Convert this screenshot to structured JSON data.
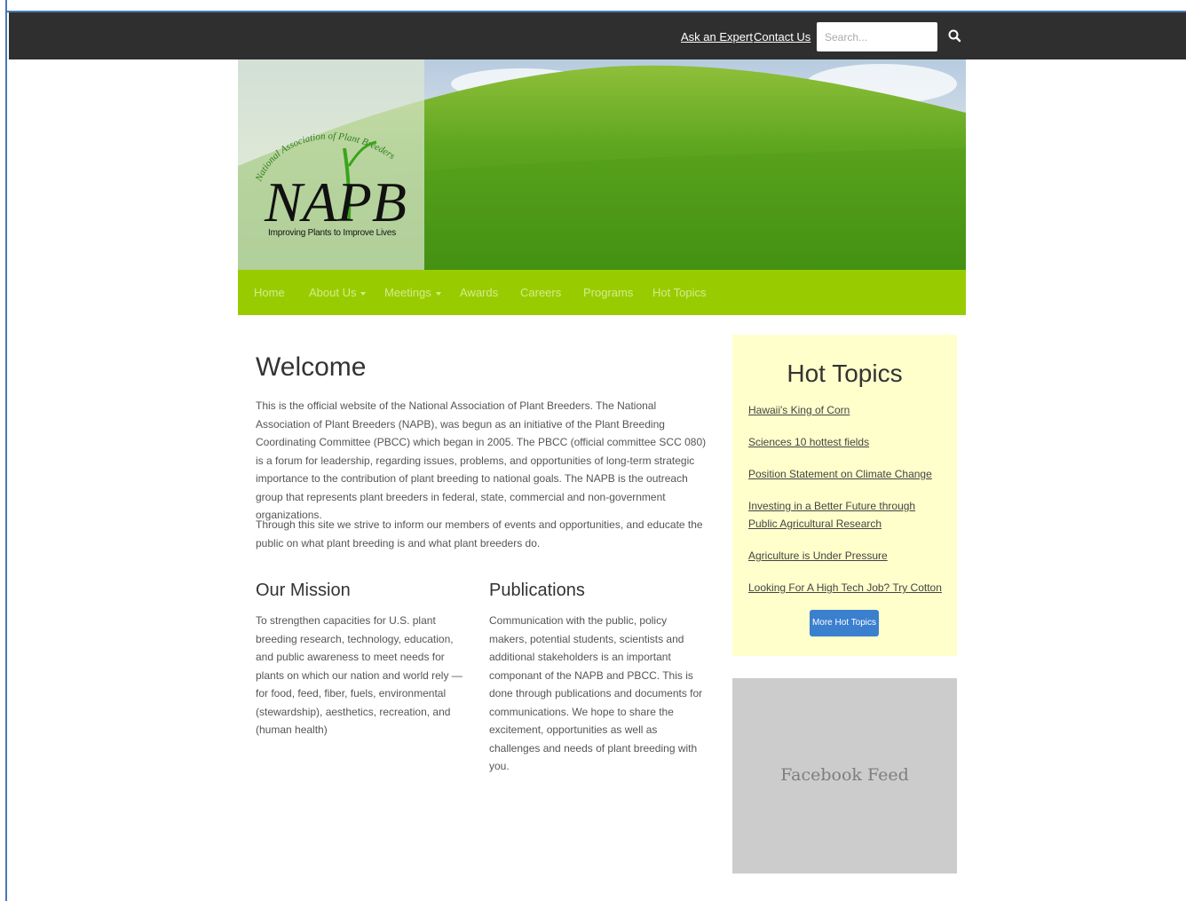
{
  "topbar": {
    "links": [
      "Ask an Expert",
      "Contact Us"
    ],
    "search_placeholder": "Search...",
    "search_icon": "search-icon"
  },
  "logo": {
    "arc_text": "National Association of Plant Breeders",
    "letters": "NAPB",
    "tagline": "Improving Plants to Improve Lives"
  },
  "nav": {
    "items": [
      "Home",
      "About Us",
      "Meetings",
      "Awards",
      "Careers",
      "Programs",
      "Hot Topics"
    ]
  },
  "main": {
    "welcome_title": "Welcome",
    "intro": "This is the official website of the National Association of Plant Breeders. The National Association of Plant Breeders (NAPB), was begun as an initiative of the Plant Breeding Coordinating Committee (PBCC) which began in 2005. The PBCC (official committee SCC 080) is a forum for leadership, regarding issues, problems, and opportunities of long-term strategic importance to the contribution of plant breeding to national goals. The NAPB is the outreach group that represents plant breeders in federal, state, commercial and non-government organizations.",
    "intro2": "Through this site we strive to inform our members of events and opportunities, and educate the public on what plant breeding is and what plant breeders do.",
    "mission_title": "Our Mission",
    "mission_text": "To strengthen capacities for U.S. plant breeding research, technology, education, and public awareness to meet needs for plants on which our nation and world rely — for food, feed, fiber, fuels, environmental (stewardship), aesthetics, recreation, and (human health)",
    "pubs_title": "Publications",
    "pubs_text": "Communication with the public, policy makers, potential students, scientists and additional stakeholders is an important componant of the NAPB and PBCC. This is done through publications and documents for communications. We hope to share the excitement, opportunities as well as challenges and needs of plant breeding with you."
  },
  "hot_topics": {
    "title": "Hot Topics",
    "links": [
      "Hawaii's King of Corn",
      "Sciences 10 hottest fields",
      "Position Statement on Climate Change",
      "Investing in a Better Future through Public Agricultural Research",
      "Agriculture is Under Pressure",
      "Looking For A High Tech Job? Try Cotton"
    ],
    "button": "More Hot Topics"
  },
  "facebook": {
    "label": "Facebook Feed"
  },
  "colors": {
    "topbar": "#2f2f2f",
    "nav": "#99cc00",
    "hot_topics_bg": "#ffffcc",
    "button": "#3b7fcf",
    "facebook_bg": "#cccccc"
  }
}
